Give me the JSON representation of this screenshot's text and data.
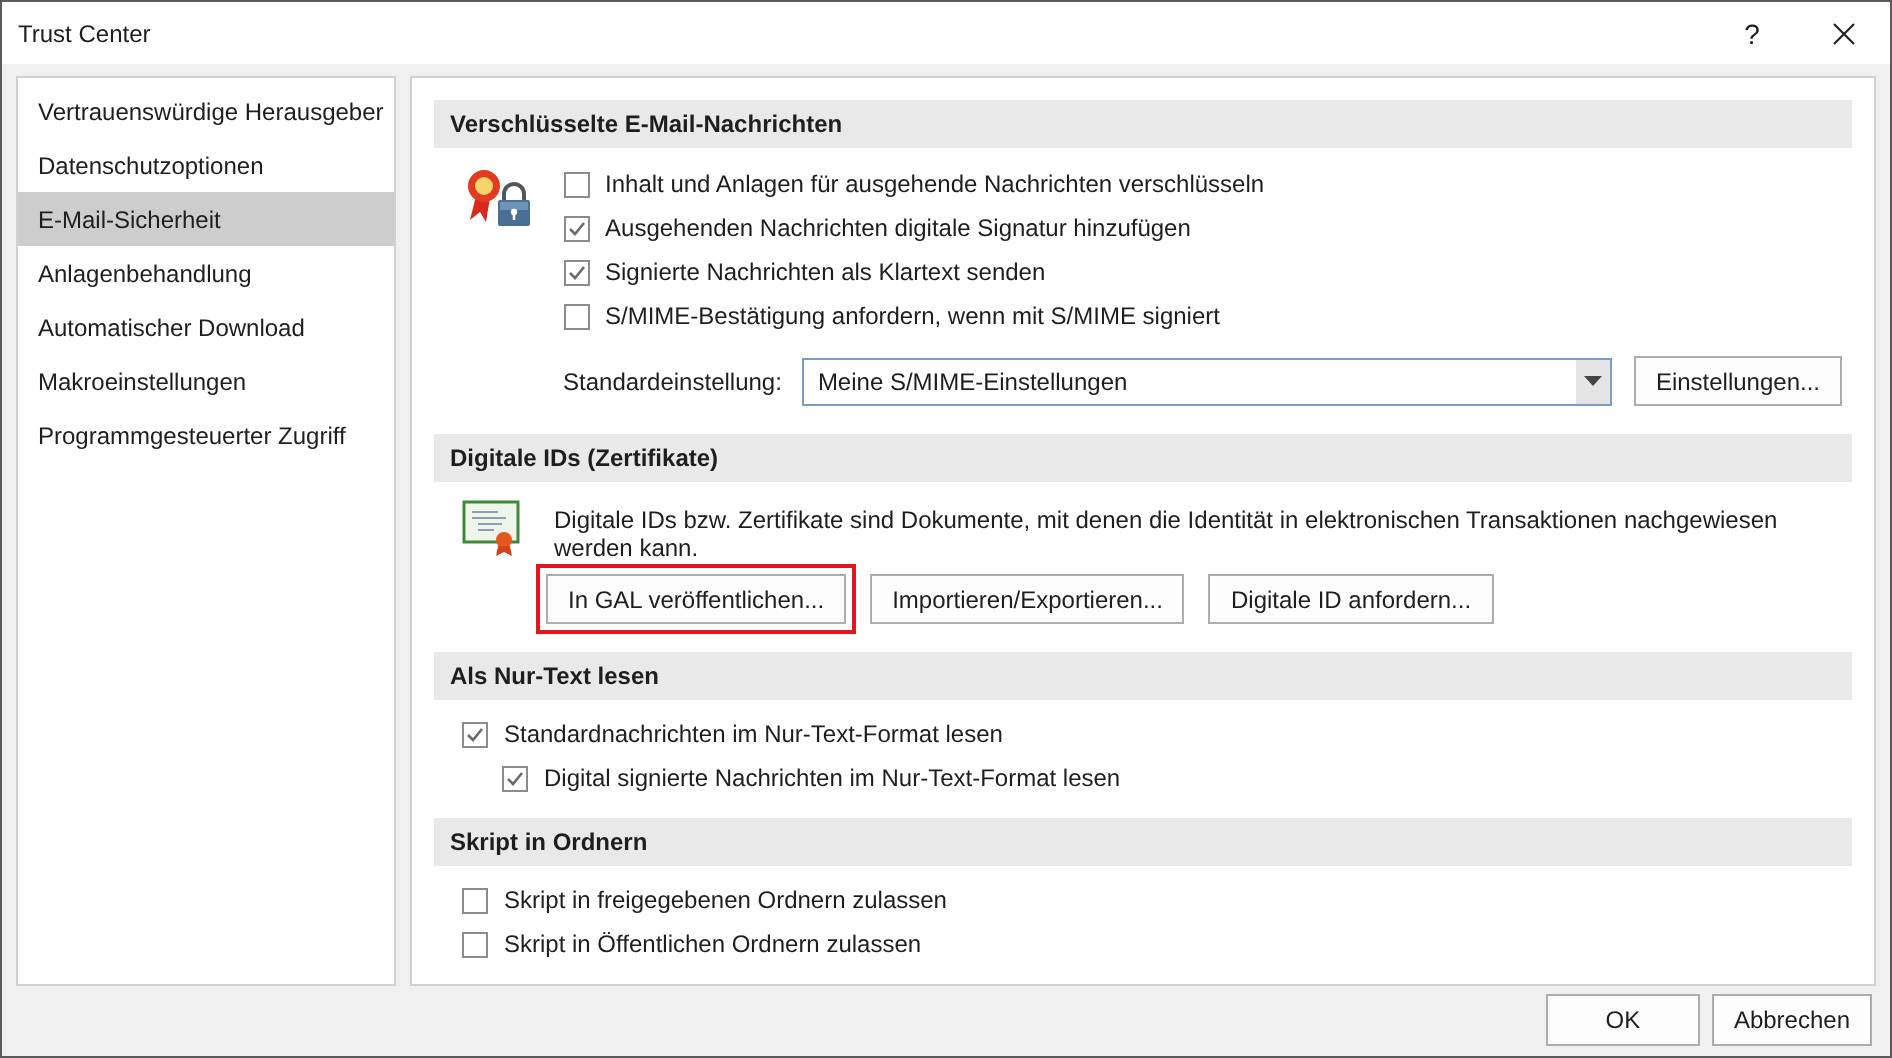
{
  "window": {
    "title": "Trust Center",
    "help_button": "?"
  },
  "sidebar": {
    "items": [
      {
        "label": "Vertrauenswürdige Herausgeber",
        "selected": false
      },
      {
        "label": "Datenschutzoptionen",
        "selected": false
      },
      {
        "label": "E-Mail-Sicherheit",
        "selected": true
      },
      {
        "label": "Anlagenbehandlung",
        "selected": false
      },
      {
        "label": "Automatischer Download",
        "selected": false
      },
      {
        "label": "Makroeinstellungen",
        "selected": false
      },
      {
        "label": "Programmgesteuerter Zugriff",
        "selected": false
      }
    ]
  },
  "sections": [
    {
      "kind": "encryption",
      "heading": "Verschlüsselte E-Mail-Nachrichten",
      "checkboxes": [
        {
          "label": "Inhalt und Anlagen für ausgehende Nachrichten verschlüsseln",
          "checked": false
        },
        {
          "label": "Ausgehenden Nachrichten digitale Signatur hinzufügen",
          "checked": true
        },
        {
          "label": "Signierte Nachrichten als Klartext senden",
          "checked": true
        },
        {
          "label": "S/MIME-Bestätigung anfordern, wenn mit S/MIME signiert",
          "checked": false
        }
      ],
      "default_setting": {
        "label": "Standardeinstellung:",
        "value": "Meine S/MIME-Einstellungen"
      },
      "buttons": [
        {
          "label": "Einstellungen...",
          "highlighted": false
        }
      ]
    },
    {
      "kind": "digital_ids",
      "heading": "Digitale IDs (Zertifikate)",
      "description": "Digitale IDs bzw. Zertifikate sind Dokumente, mit denen die Identität in elektronischen Transaktionen nachgewiesen werden kann.",
      "buttons": [
        {
          "label": "In GAL veröffentlichen...",
          "highlighted": true
        },
        {
          "label": "Importieren/Exportieren...",
          "highlighted": false
        },
        {
          "label": "Digitale ID anfordern...",
          "highlighted": false
        }
      ]
    },
    {
      "kind": "plain_text",
      "heading": "Als Nur-Text lesen",
      "checkboxes": [
        {
          "label": "Standardnachrichten im Nur-Text-Format lesen",
          "checked": true,
          "children": [
            {
              "label": "Digital signierte Nachrichten im Nur-Text-Format lesen",
              "checked": true
            }
          ]
        }
      ]
    },
    {
      "kind": "scripts",
      "heading": "Skript in Ordnern",
      "checkboxes": [
        {
          "label": "Skript in freigegebenen Ordnern zulassen",
          "checked": false
        },
        {
          "label": "Skript in Öffentlichen Ordnern zulassen",
          "checked": false
        }
      ]
    }
  ],
  "footer": {
    "buttons": [
      "OK",
      "Abbrechen"
    ]
  }
}
